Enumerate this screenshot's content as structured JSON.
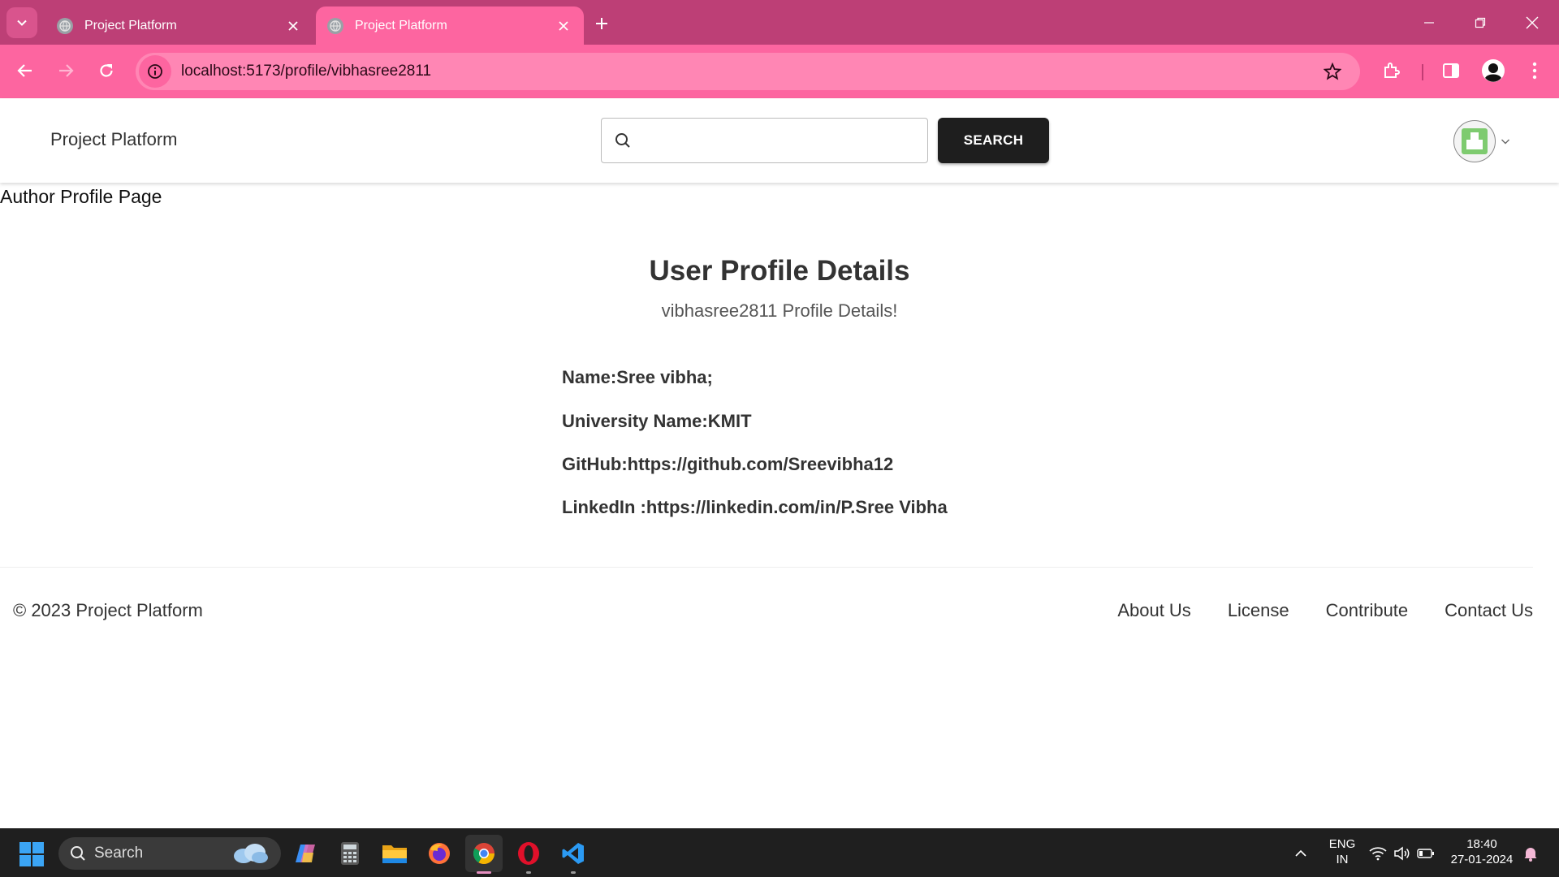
{
  "browser": {
    "tabs": [
      {
        "title": "Project Platform",
        "active": false
      },
      {
        "title": "Project Platform",
        "active": true
      }
    ],
    "url": "localhost:5173/profile/vibhasree2811"
  },
  "header": {
    "brand": "Project Platform",
    "search_placeholder": "",
    "search_button": "SEARCH"
  },
  "page": {
    "label": "Author Profile Page",
    "title": "User Profile Details",
    "subtitle": "vibhasree2811 Profile Details!",
    "details": {
      "name": "Name:Sree vibha;",
      "university": "University Name:KMIT",
      "github": "GitHub:https://github.com/Sreevibha12",
      "linkedin": "LinkedIn :https://linkedin.com/in/P.Sree Vibha"
    }
  },
  "footer": {
    "copyright": "© 2023 Project Platform",
    "links": [
      "About Us",
      "License",
      "Contribute",
      "Contact Us"
    ]
  },
  "taskbar": {
    "search_label": "Search",
    "language": "ENG",
    "region": "IN",
    "time": "18:40",
    "date": "27-01-2024"
  },
  "colors": {
    "tabstrip": "#bd3f76",
    "toolbar": "#fd65a0",
    "search_button": "#1e1e1e"
  }
}
